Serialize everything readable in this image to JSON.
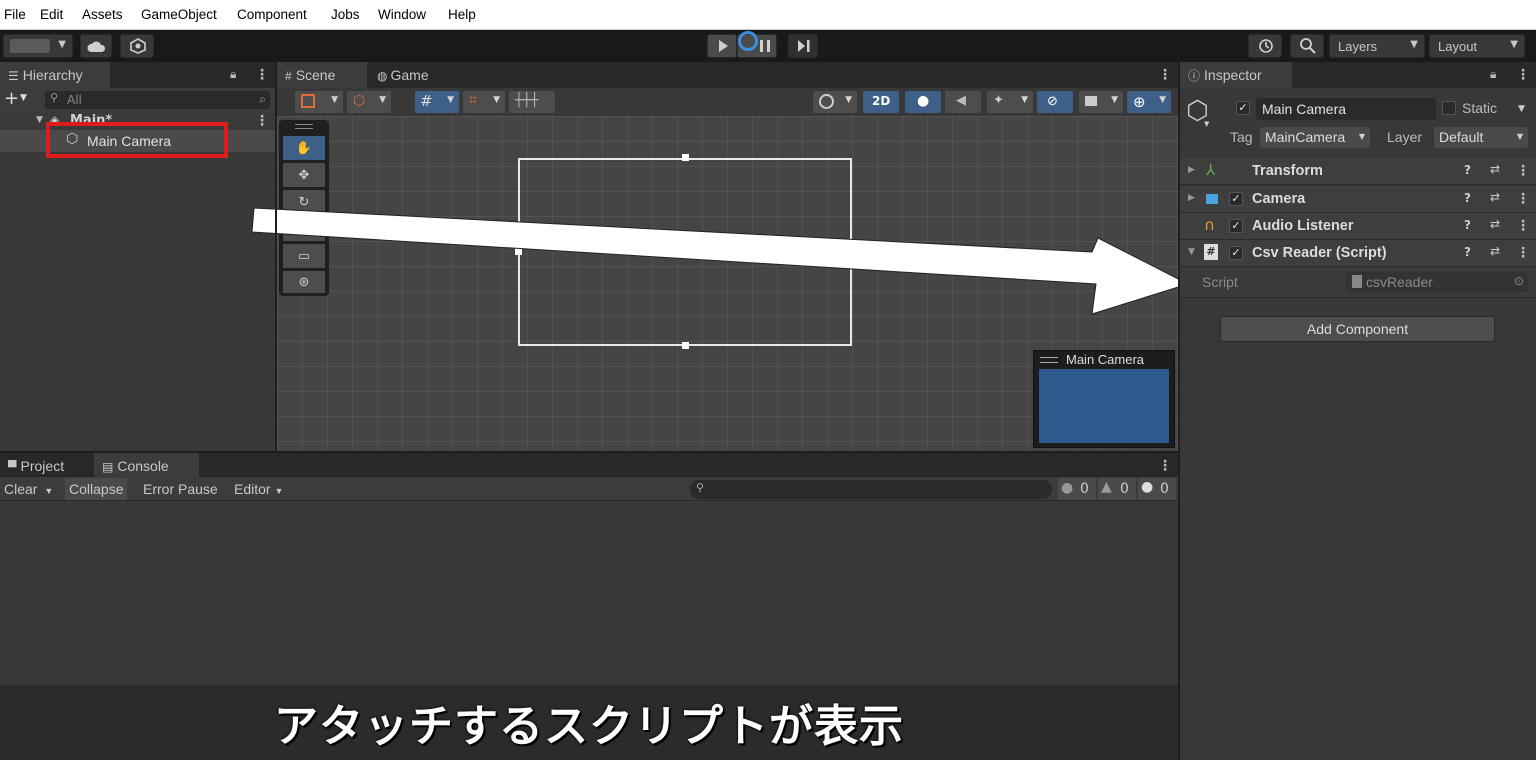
{
  "menu": [
    "File",
    "Edit",
    "Assets",
    "GameObject",
    "Component",
    "Jobs",
    "Window",
    "Help"
  ],
  "toolbar": {
    "layers_label": "Layers",
    "layout_label": "Layout"
  },
  "hierarchy": {
    "tab": "Hierarchy",
    "search_placeholder": "All",
    "scene_name": "Main*",
    "items": [
      {
        "label": "Main Camera"
      }
    ],
    "highlight_color": "#e01b1b"
  },
  "scene": {
    "tabs": [
      "Scene",
      "Game"
    ],
    "mode_2d": "2D",
    "camera_preview_title": "Main Camera",
    "preview_color": "#2e5a8e"
  },
  "inspector": {
    "tab": "Inspector",
    "object_name": "Main Camera",
    "static_label": "Static",
    "tag_label": "Tag",
    "tag_value": "MainCamera",
    "layer_label": "Layer",
    "layer_value": "Default",
    "components": [
      {
        "name": "Transform",
        "icon": "transform-icon",
        "has_checkbox": false
      },
      {
        "name": "Camera",
        "icon": "camera-icon",
        "has_checkbox": true
      },
      {
        "name": "Audio Listener",
        "icon": "headphones-icon",
        "has_checkbox": true
      },
      {
        "name": "Csv Reader (Script)",
        "icon": "script-icon",
        "has_checkbox": true
      }
    ],
    "script_label": "Script",
    "script_value": "csvReader",
    "add_component": "Add Component"
  },
  "bottom": {
    "tabs": [
      "Project",
      "Console"
    ],
    "console_buttons": [
      "Clear",
      "Collapse",
      "Error Pause",
      "Editor"
    ],
    "counts": {
      "info": "0",
      "warning": "0",
      "error": "0"
    }
  },
  "caption": "アタッチするスクリプトが表示"
}
